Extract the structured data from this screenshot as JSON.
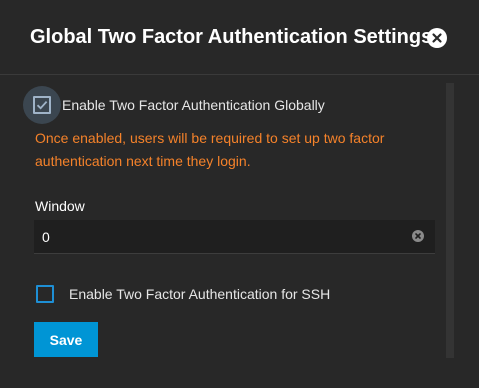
{
  "dialog": {
    "title": "Global Two Factor Authentication Settings",
    "close_icon": "close-circle-icon"
  },
  "form": {
    "enable_global": {
      "label": "Enable Two Factor Authentication Globally",
      "checked": true
    },
    "warning": "Once enabled, users will be required to set up two factor authentication next time they login.",
    "window": {
      "label": "Window",
      "value": "0",
      "clear_icon": "clear-circle-icon"
    },
    "enable_ssh": {
      "label": "Enable Two Factor Authentication for SSH",
      "checked": false
    },
    "save_label": "Save"
  },
  "colors": {
    "background": "#282828",
    "accent": "#0095d5",
    "warning": "#f5822a",
    "text": "#ffffff"
  }
}
